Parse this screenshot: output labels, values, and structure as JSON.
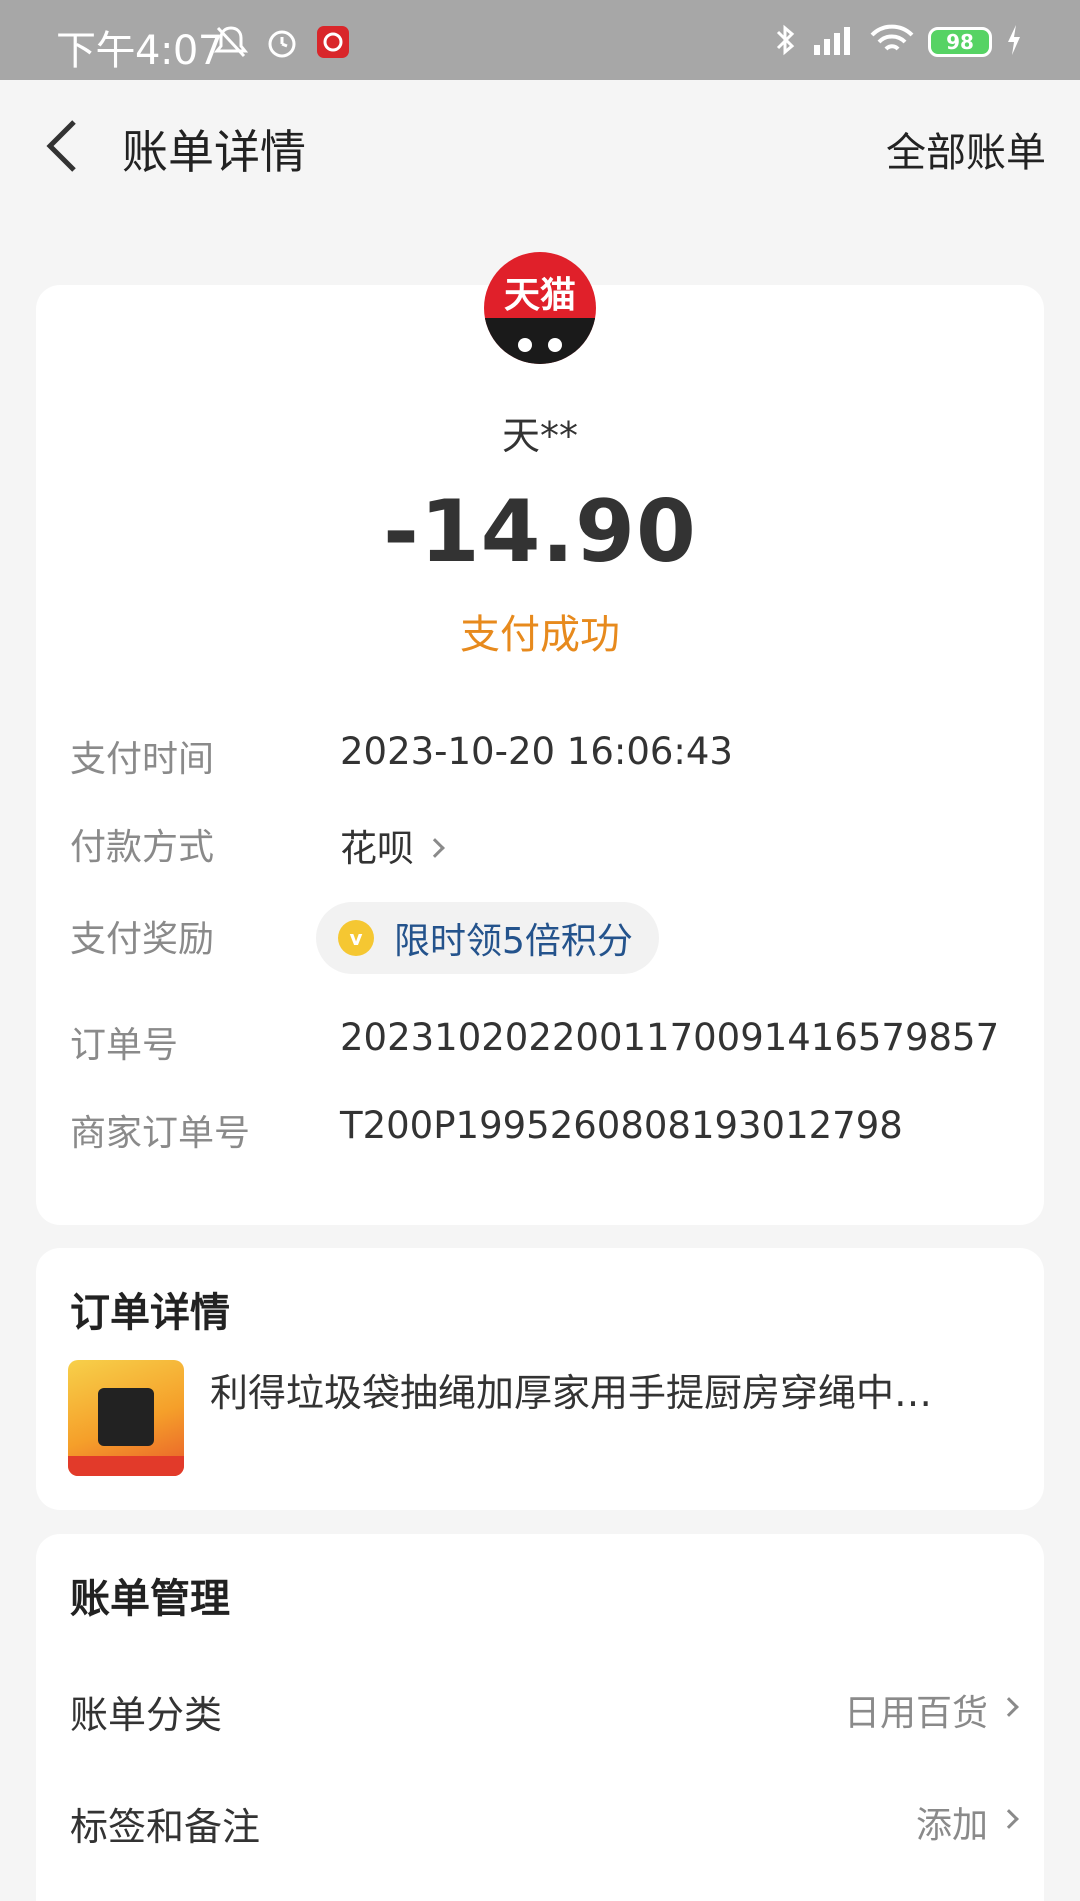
{
  "status_bar": {
    "time": "下午4:07",
    "battery": "98",
    "icons_left": [
      "bell-off-icon",
      "alarm-icon",
      "app-notification-icon"
    ],
    "icons_right": [
      "bluetooth-icon",
      "signal-icon",
      "wifi-icon",
      "battery-icon",
      "charging-icon"
    ]
  },
  "header": {
    "title": "账单详情",
    "right_link": "全部账单"
  },
  "merchant": {
    "logo_text": "天猫",
    "name": "天**"
  },
  "transaction": {
    "amount": "-14.90",
    "status": "支付成功",
    "status_color": "#e78a1d"
  },
  "details": {
    "pay_time_label": "支付时间",
    "pay_time": "2023-10-20 16:06:43",
    "method_label": "付款方式",
    "method": "花呗",
    "reward_label": "支付奖励",
    "reward": "限时领5倍积分",
    "order_no_label": "订单号",
    "order_no": "2023102022001170091416579857",
    "merchant_order_label": "商家订单号",
    "merchant_order": "T200P1995260808193012798"
  },
  "order_details": {
    "title": "订单详情",
    "product_name": "利得垃圾袋抽绳加厚家用手提厨房穿绳中…"
  },
  "bill_management": {
    "title": "账单管理",
    "category_label": "账单分类",
    "category_value": "日用百货",
    "tags_label": "标签和备注",
    "tags_value": "添加"
  }
}
